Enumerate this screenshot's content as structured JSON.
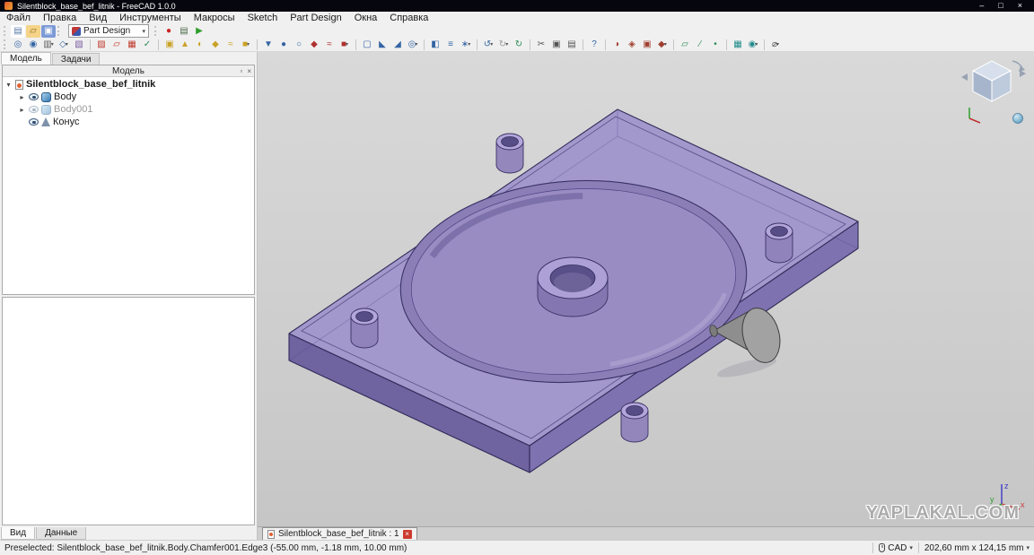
{
  "window": {
    "title": "Silentblock_base_bef_litnik - FreeCAD 1.0.0",
    "minimize": "–",
    "maximize": "□",
    "close": "×"
  },
  "ui": {
    "caret": "▾",
    "expander_open": "▾",
    "expander_closed": "▸",
    "undock": "▫"
  },
  "menubar": {
    "items": [
      "Файл",
      "Правка",
      "Вид",
      "Инструменты",
      "Макросы",
      "Sketch",
      "Part Design",
      "Окна",
      "Справка"
    ]
  },
  "toolbar_file": {
    "icons": [
      {
        "name": "new-document-icon",
        "glyph": "▤",
        "fg": "#5a7aa8",
        "bg": "#ffffff"
      },
      {
        "name": "open-document-icon",
        "glyph": "▱",
        "fg": "#8a6a20",
        "bg": "#f5d489"
      },
      {
        "name": "save-icon",
        "glyph": "▣",
        "fg": "#ffffff",
        "bg": "#7d9bd6"
      }
    ],
    "workbench": {
      "value": "Part Design"
    },
    "macro_icons": [
      {
        "name": "record-macro-icon",
        "glyph": "●",
        "fg": "#cc2222"
      },
      {
        "name": "macros-dialog-icon",
        "glyph": "▤",
        "fg": "#4a6a4a"
      },
      {
        "name": "execute-macro-icon",
        "glyph": "▶",
        "fg": "#2e9e2e"
      }
    ]
  },
  "toolbar_main": {
    "items": [
      {
        "name": "fit-all-icon",
        "glyph": "◎",
        "fg": "#3465a4"
      },
      {
        "name": "fit-selection-icon",
        "glyph": "◉",
        "fg": "#3465a4"
      },
      {
        "name": "draw-style-icon",
        "glyph": "▥",
        "fg": "#5a5a5a",
        "caret": true
      },
      {
        "name": "isometric-view-icon",
        "glyph": "◇",
        "fg": "#3465a4",
        "caret": true
      },
      {
        "name": "appearance-icon",
        "glyph": "▧",
        "fg": "#7a5aa0"
      },
      {
        "sep": true
      },
      {
        "name": "create-sketch-icon",
        "glyph": "▨",
        "fg": "#c0392b"
      },
      {
        "name": "edit-sketch-icon",
        "glyph": "▱",
        "fg": "#c0392b"
      },
      {
        "name": "map-sketch-icon",
        "glyph": "▦",
        "fg": "#c0392b"
      },
      {
        "name": "validate-sketch-icon",
        "glyph": "✓",
        "fg": "#2e8b57"
      },
      {
        "sep": true
      },
      {
        "name": "create-body-icon",
        "glyph": "▣",
        "fg": "#c9a227"
      },
      {
        "name": "pad-icon",
        "glyph": "▲",
        "fg": "#c9a227"
      },
      {
        "name": "revolution-icon",
        "glyph": "◐",
        "fg": "#c9a227"
      },
      {
        "name": "additive-loft-icon",
        "glyph": "◆",
        "fg": "#c9a227"
      },
      {
        "name": "additive-pipe-icon",
        "glyph": "≈",
        "fg": "#c9a227"
      },
      {
        "name": "additive-primitive-icon",
        "glyph": "■",
        "fg": "#c9a227",
        "caret": true
      },
      {
        "sep": true
      },
      {
        "name": "pocket-icon",
        "glyph": "▼",
        "fg": "#3465a4"
      },
      {
        "name": "hole-icon",
        "glyph": "●",
        "fg": "#3465a4"
      },
      {
        "name": "groove-icon",
        "glyph": "○",
        "fg": "#3465a4"
      },
      {
        "name": "subtractive-loft-icon",
        "glyph": "◆",
        "fg": "#b03030"
      },
      {
        "name": "subtractive-pipe-icon",
        "glyph": "≈",
        "fg": "#b03030"
      },
      {
        "name": "subtractive-primitive-icon",
        "glyph": "■",
        "fg": "#b03030",
        "caret": true
      },
      {
        "sep": true
      },
      {
        "name": "fillet-icon",
        "glyph": "▢",
        "fg": "#3465a4"
      },
      {
        "name": "chamfer-icon",
        "glyph": "◣",
        "fg": "#3465a4"
      },
      {
        "name": "draft-icon",
        "glyph": "◢",
        "fg": "#3465a4"
      },
      {
        "name": "thickness-icon",
        "glyph": "◎",
        "fg": "#3465a4",
        "caret": true
      },
      {
        "sep": true
      },
      {
        "name": "mirrored-icon",
        "glyph": "◧",
        "fg": "#3465a4"
      },
      {
        "name": "linear-pattern-icon",
        "glyph": "≡",
        "fg": "#3465a4"
      },
      {
        "name": "polar-pattern-icon",
        "glyph": "∗",
        "fg": "#3465a4",
        "caret": true
      },
      {
        "sep": true
      },
      {
        "name": "undo-icon",
        "glyph": "↺",
        "fg": "#3465a4",
        "caret": true
      },
      {
        "name": "redo-icon",
        "glyph": "↻",
        "fg": "#9a9a9a",
        "caret": true
      },
      {
        "name": "refresh-icon",
        "glyph": "↻",
        "fg": "#2e8b57"
      },
      {
        "sep": true
      },
      {
        "name": "cut-icon",
        "glyph": "✂",
        "fg": "#555555"
      },
      {
        "name": "copy-icon",
        "glyph": "▣",
        "fg": "#555555"
      },
      {
        "name": "paste-icon",
        "glyph": "▤",
        "fg": "#555555"
      },
      {
        "sep": true
      },
      {
        "name": "whats-this-icon",
        "glyph": "?",
        "fg": "#3465a4"
      },
      {
        "sep": true
      },
      {
        "name": "boolean-operation-icon",
        "glyph": "◑",
        "fg": "#a04030"
      },
      {
        "name": "shape-binder-icon",
        "glyph": "◈",
        "fg": "#a04030"
      },
      {
        "name": "clone-icon",
        "glyph": "▣",
        "fg": "#a04030"
      },
      {
        "name": "migrate-icon",
        "glyph": "◆",
        "fg": "#a04030",
        "caret": true
      },
      {
        "sep": true
      },
      {
        "name": "datum-plane-icon",
        "glyph": "▱",
        "fg": "#2e8b57"
      },
      {
        "name": "datum-line-icon",
        "glyph": "∕",
        "fg": "#2e8b57"
      },
      {
        "name": "datum-point-icon",
        "glyph": "•",
        "fg": "#2e8b57"
      },
      {
        "sep": true
      },
      {
        "name": "grid-icon",
        "glyph": "▦",
        "fg": "#1f8a8a"
      },
      {
        "name": "snap-icon",
        "glyph": "◉",
        "fg": "#1f8a8a",
        "caret": true
      },
      {
        "sep": true
      },
      {
        "name": "measure-icon",
        "glyph": "⌀",
        "fg": "#555555",
        "caret": true
      }
    ]
  },
  "combo_view": {
    "tabs": [
      {
        "label": "Модель",
        "active": true
      },
      {
        "label": "Задачи",
        "active": false
      }
    ],
    "panel_title": "Модель"
  },
  "tree": {
    "document": {
      "label": "Silentblock_base_bef_litnik"
    },
    "items": [
      {
        "label": "Body",
        "type": "body",
        "hidden": false,
        "expandable": true
      },
      {
        "label": "Body001",
        "type": "body",
        "hidden": true,
        "expandable": true
      },
      {
        "label": "Конус",
        "type": "cone",
        "hidden": false,
        "expandable": false
      }
    ]
  },
  "property_tabs": [
    {
      "label": "Вид",
      "active": true
    },
    {
      "label": "Данные",
      "active": false
    }
  ],
  "viewport": {
    "document_tab": "Silentblock_base_bef_litnik : 1",
    "watermark": "YAPLAKAL.COM",
    "axes": {
      "x": "x",
      "y": "y",
      "z": "z"
    }
  },
  "statusbar": {
    "message": "Preselected: Silentblock_base_bef_litnik.Body.Chamfer001.Edge3 (-55.00 mm, -1.18 mm, 10.00 mm)",
    "nav_style": "CAD",
    "view_size": "202,60 mm x 124,15 mm"
  },
  "colors": {
    "model_top": "#a196cb",
    "model_side": "#7f72b0",
    "model_floor": "#998cc3",
    "model_edge": "#312b59",
    "cone": "#8e8e8e",
    "viewport_bg": "#d2d2d2",
    "titlebar": "#06060f",
    "close_tab": "#cc3b2f"
  }
}
